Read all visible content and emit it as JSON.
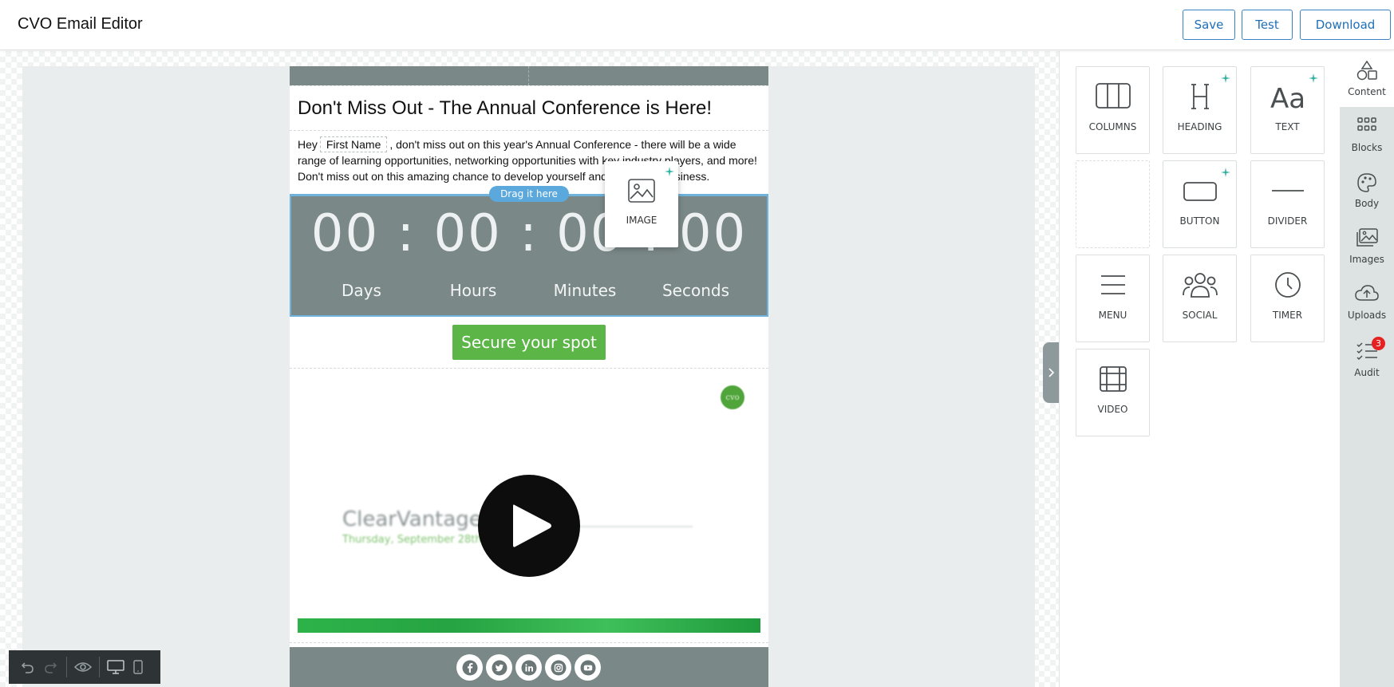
{
  "app": {
    "title": "CVO Email Editor",
    "save_label": "Save",
    "test_label": "Test",
    "download_label": "Download"
  },
  "email": {
    "heading": "Don't Miss Out - The Annual Conference is Here!",
    "text_before": "Hey",
    "merge_tag": "First Name",
    "text_after": ", don't miss out on this year's Annual Conference - there will be a wide range of learning opportunities, networking opportunities with key industry players, and more! Don't miss out on this amazing chance to develop yourself and grow your business.",
    "drag_hint": "Drag it here",
    "timer": {
      "digits": "00 : 00 : 00 : 00",
      "labels": [
        "Days",
        "Hours",
        "Minutes",
        "Seconds"
      ]
    },
    "cta_label": "Secure your spot",
    "video": {
      "badge_text": "cvo",
      "title": "ClearVantage W",
      "subtitle": "Thursday, September 28th @"
    },
    "social_icons": [
      "facebook-icon",
      "twitter-icon",
      "linkedin-icon",
      "instagram-icon",
      "youtube-icon"
    ]
  },
  "dragging_tool": {
    "label": "IMAGE"
  },
  "content_tools": [
    {
      "label": "COLUMNS",
      "icon": "columns-icon",
      "ai": false
    },
    {
      "label": "HEADING",
      "icon": "heading-icon",
      "ai": true
    },
    {
      "label": "TEXT",
      "icon": "text-icon",
      "ai": true
    },
    {
      "label": "BUTTON",
      "icon": "button-icon",
      "ai": true
    },
    {
      "label": "DIVIDER",
      "icon": "divider-icon",
      "ai": false
    },
    {
      "label": "MENU",
      "icon": "menu-icon",
      "ai": false
    },
    {
      "label": "SOCIAL",
      "icon": "social-icon",
      "ai": false
    },
    {
      "label": "TIMER",
      "icon": "timer-icon",
      "ai": false
    },
    {
      "label": "VIDEO",
      "icon": "video-icon",
      "ai": false
    }
  ],
  "side_tabs": [
    {
      "label": "Content",
      "icon": "shapes-icon",
      "active": true
    },
    {
      "label": "Blocks",
      "icon": "blocks-icon",
      "active": false
    },
    {
      "label": "Body",
      "icon": "palette-icon",
      "active": false
    },
    {
      "label": "Images",
      "icon": "images-icon",
      "active": false
    },
    {
      "label": "Uploads",
      "icon": "upload-cloud-icon",
      "active": false
    },
    {
      "label": "Audit",
      "icon": "checklist-icon",
      "active": false,
      "badge": "3"
    }
  ],
  "colors": {
    "accent": "#1e6fb8",
    "block_gray": "#7b8888",
    "cta_green": "#5cb547",
    "selection_blue": "#6fb2dc",
    "ai_sparkle": "#2bb3a0",
    "badge_red": "#e52121"
  }
}
